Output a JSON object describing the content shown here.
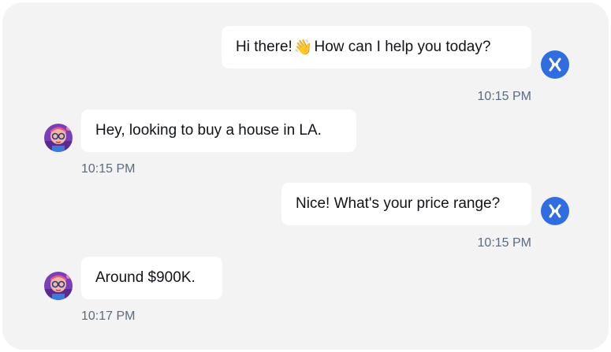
{
  "chat": {
    "messages": [
      {
        "sender": "agent",
        "text_before": "Hi there! ",
        "emoji": "👋",
        "text_after": " How can I help you today?",
        "time": "10:15 PM"
      },
      {
        "sender": "user",
        "text": "Hey, looking to buy a house in LA.",
        "time": "10:15 PM"
      },
      {
        "sender": "agent",
        "text": "Nice! What's your price range?",
        "time": "10:15 PM"
      },
      {
        "sender": "user",
        "text": "Around $900K.",
        "time": "10:17 PM"
      }
    ]
  },
  "colors": {
    "panel_background": "#f3f3f4",
    "bubble_background": "#ffffff",
    "agent_avatar": "#2f6de0",
    "timestamp": "#5d6b7e"
  },
  "icons": {
    "agent_avatar": "x-logo-icon",
    "user_avatar": "cartoon-avatar-icon"
  }
}
